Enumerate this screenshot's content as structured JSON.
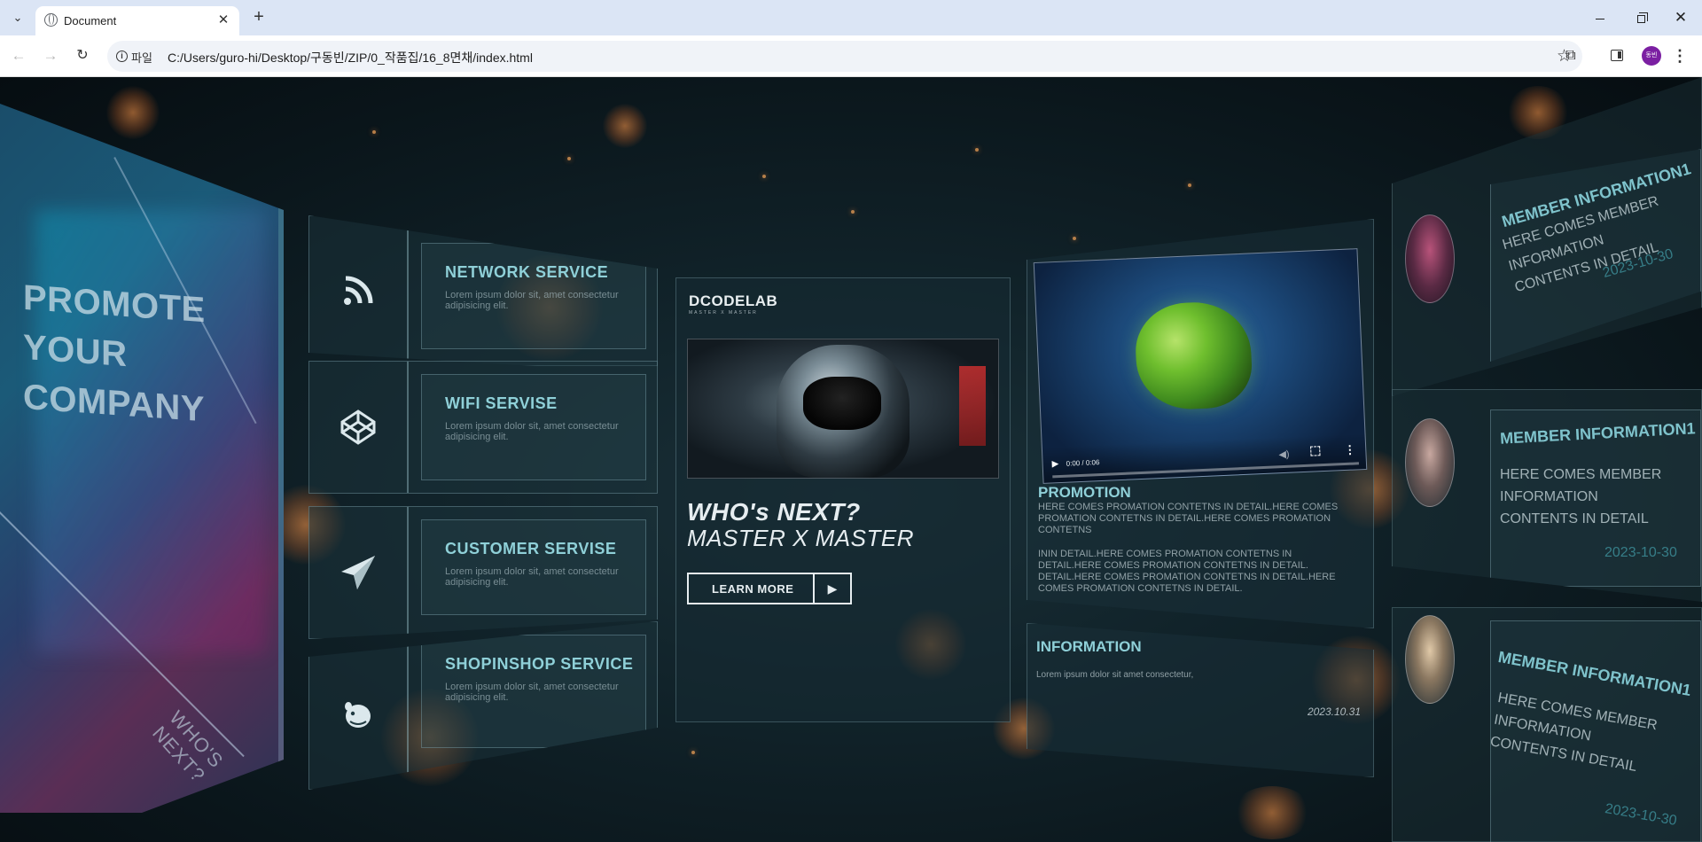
{
  "browser": {
    "tab_title": "Document",
    "scheme_label": "파일",
    "url": "C:/Users/guro-hi/Desktop/구동빈/ZIP/0_작품집/16_8면채/index.html",
    "profile_initials": "동빈"
  },
  "promo": {
    "title_lines": [
      "PROMOTE",
      "YOUR",
      "COMPANY"
    ],
    "tagline": "WHO'S NEXT?"
  },
  "services": [
    {
      "title": "NETWORK SERVICE",
      "icon": "rss-icon",
      "text": "Lorem ipsum dolor sit, amet consectetur adipisicing elit."
    },
    {
      "title": "WIFI SERVISE",
      "icon": "codepen-icon",
      "text": "Lorem ipsum dolor sit, amet consectetur adipisicing elit."
    },
    {
      "title": "CUSTOMER SERVISE",
      "icon": "paper-plane-icon",
      "text": "Lorem ipsum dolor sit, amet consectetur adipisicing elit."
    },
    {
      "title": "SHOPINSHOP SERVICE",
      "icon": "mailchimp-icon",
      "text": "Lorem ipsum dolor sit, amet consectetur adipisicing elit."
    }
  ],
  "center": {
    "logo": "DCODELAB",
    "logo_sub": "MASTER X MASTER",
    "headline": "WHO's NEXT?",
    "subheadline": "MASTER X MASTER",
    "cta_label": "LEARN MORE"
  },
  "video": {
    "time": "0:00 / 0:06",
    "progress": 0
  },
  "promotion": {
    "title": "PROMOTION",
    "para1": "HERE COMES PROMATION CONTETNS IN DETAIL.HERE COMES PROMATION CONTETNS IN DETAIL.HERE COMES PROMATION CONTETNS",
    "para2": "ININ DETAIL.HERE COMES PROMATION CONTETNS IN DETAIL.HERE COMES PROMATION CONTETNS IN DETAIL. DETAIL.HERE COMES PROMATION CONTETNS IN DETAIL.HERE COMES PROMATION CONTETNS IN DETAIL."
  },
  "information": {
    "title": "INFORMATION",
    "text": "Lorem ipsum dolor sit amet consectetur,",
    "date": "2023.10.31"
  },
  "members": [
    {
      "title": "MEMBER INFORMATION1",
      "text": "HERE COMES MEMBER INFORMATION CONTENTS IN DETAIL",
      "date": "2023-10-30"
    },
    {
      "title": "MEMBER INFORMATION1",
      "text": "HERE COMES MEMBER INFORMATION CONTENTS IN DETAIL",
      "date": "2023-10-30"
    },
    {
      "title": "MEMBER INFORMATION1",
      "text": "HERE COMES MEMBER INFORMATION CONTENTS IN DETAIL",
      "date": "2023-10-30"
    }
  ],
  "colors": {
    "accent": "#8fd0d8",
    "tabbar": "#dbe5f5",
    "background": "#0b1419",
    "bokeh": "#e67a30"
  }
}
